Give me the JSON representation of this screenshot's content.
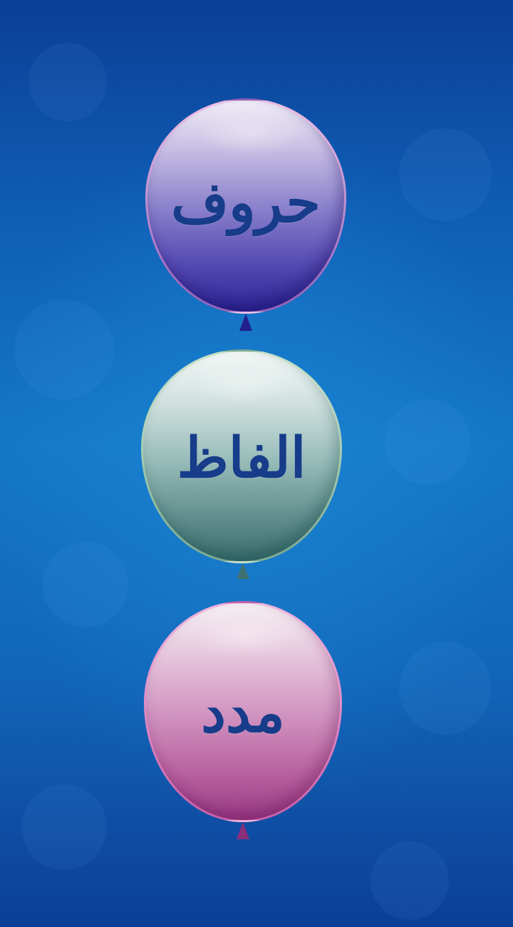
{
  "background": {
    "colors": {
      "top": "#0b3f95",
      "middle": "#1478c8",
      "bottom": "#0c3f96"
    }
  },
  "menu": {
    "items": [
      {
        "label": "حروف",
        "color": "#6f63c0"
      },
      {
        "label": "الفاظ",
        "color": "#8fb3b1"
      },
      {
        "label": "مدد",
        "color": "#c77db5"
      }
    ],
    "label_color": "#163c8a"
  }
}
